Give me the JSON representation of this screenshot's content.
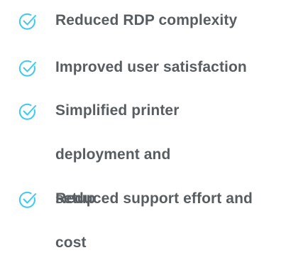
{
  "benefits": {
    "accent_color": "#3ec9ee",
    "text_color": "#585d62",
    "icon": "check-circle-icon",
    "items": [
      {
        "label": "Reduced RDP complexity"
      },
      {
        "label": "Improved user satisfaction"
      },
      {
        "label": "Simplified printer deployment and setup"
      },
      {
        "label": "Reduced support effort and cost"
      }
    ]
  }
}
